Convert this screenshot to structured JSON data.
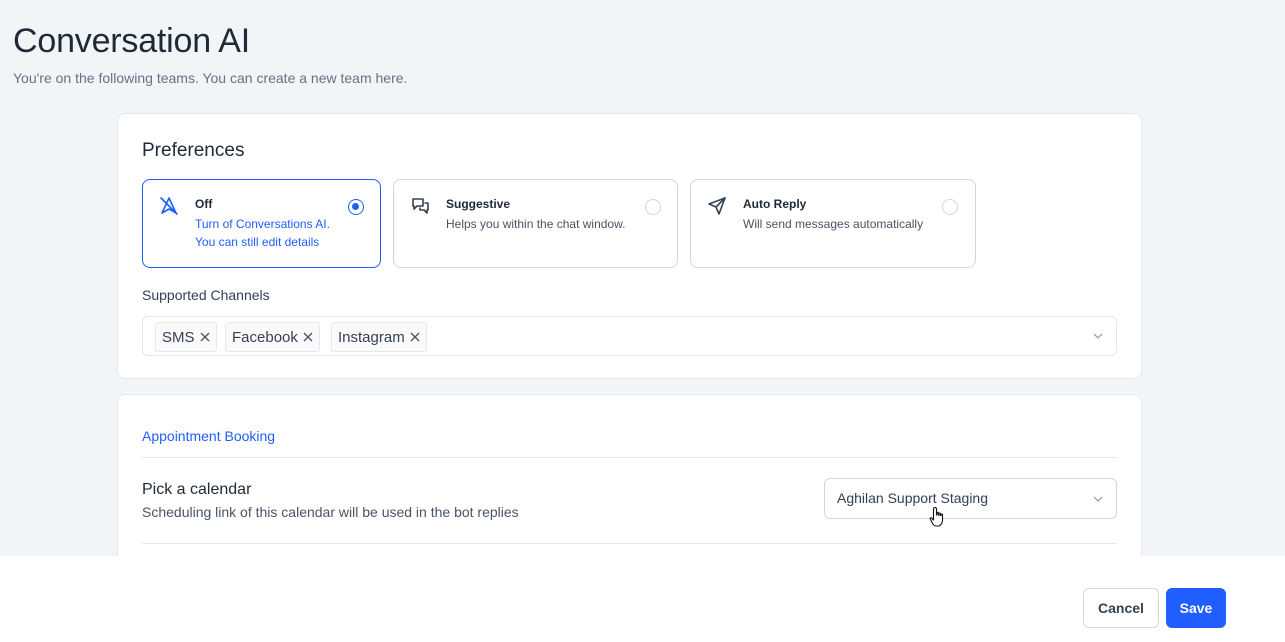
{
  "header": {
    "title": "Conversation AI",
    "subtitle": "You're on the following teams. You can create a new team here."
  },
  "preferences": {
    "title": "Preferences",
    "options": [
      {
        "title": "Off",
        "description": "Turn of Conversations AI.\nYou can still edit details",
        "icon": "no-send-icon",
        "selected": true
      },
      {
        "title": "Suggestive",
        "description": "Helps you within the chat window.",
        "icon": "chat-bubbles-icon",
        "selected": false
      },
      {
        "title": "Auto Reply",
        "description": "Will send messages automatically",
        "icon": "send-icon",
        "selected": false
      }
    ],
    "channels_label": "Supported Channels",
    "channels": [
      "SMS",
      "Facebook",
      "Instagram"
    ]
  },
  "appointment": {
    "section_link": "Appointment Booking",
    "calendar_title": "Pick a calendar",
    "calendar_description": "Scheduling link of this calendar will be used in the bot replies",
    "calendar_value": "Aghilan Support Staging"
  },
  "footer": {
    "cancel_label": "Cancel",
    "save_label": "Save"
  },
  "colors": {
    "accent": "#1f5eff",
    "background": "#f2f5f8"
  }
}
